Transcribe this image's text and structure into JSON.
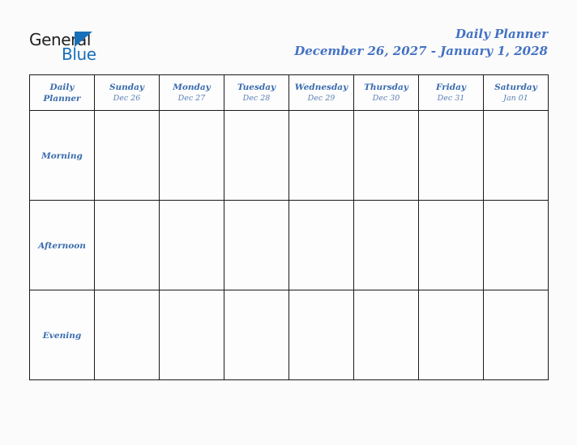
{
  "brand": {
    "name_part1": "General",
    "name_part2": "Blue",
    "triangle_icon": "brand-triangle-icon",
    "accent_blue": "#1870b9"
  },
  "header": {
    "title": "Daily Planner",
    "date_range": "December 26, 2027 - January 1, 2028",
    "title_color": "#4472c4"
  },
  "table": {
    "corner": {
      "line1": "Daily",
      "line2": "Planner"
    },
    "header_background": "#dfe8d0",
    "row_label_background": "#e9e9e9",
    "columns": [
      {
        "day": "Sunday",
        "date": "Dec 26"
      },
      {
        "day": "Monday",
        "date": "Dec 27"
      },
      {
        "day": "Tuesday",
        "date": "Dec 28"
      },
      {
        "day": "Wednesday",
        "date": "Dec 29"
      },
      {
        "day": "Thursday",
        "date": "Dec 30"
      },
      {
        "day": "Friday",
        "date": "Dec 31"
      },
      {
        "day": "Saturday",
        "date": "Jan 01"
      }
    ],
    "rows": [
      {
        "label": "Morning",
        "cells": [
          "",
          "",
          "",
          "",
          "",
          "",
          ""
        ]
      },
      {
        "label": "Afternoon",
        "cells": [
          "",
          "",
          "",
          "",
          "",
          "",
          ""
        ]
      },
      {
        "label": "Evening",
        "cells": [
          "",
          "",
          "",
          "",
          "",
          "",
          ""
        ]
      }
    ]
  }
}
